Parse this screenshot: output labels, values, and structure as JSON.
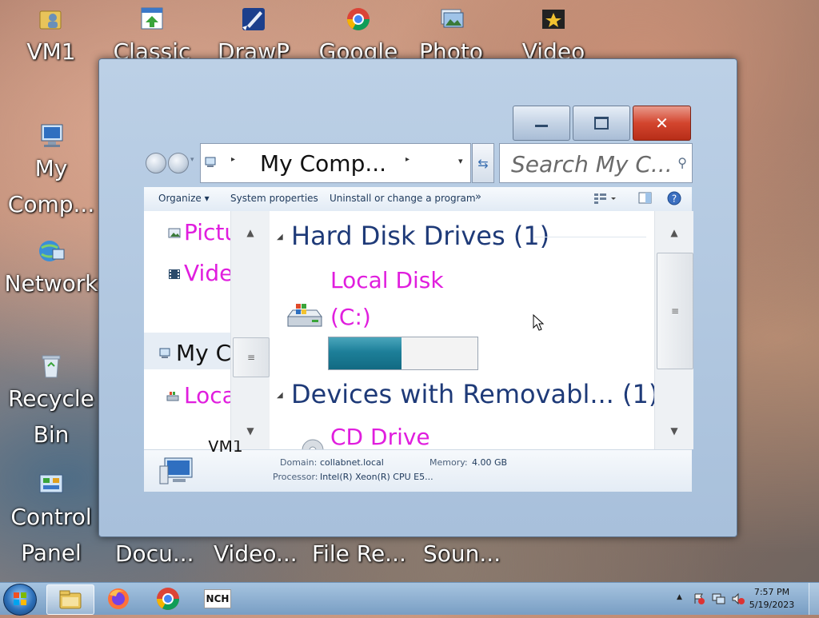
{
  "desktop": {
    "icons": [
      {
        "label": "VM1",
        "icon": "folder-user-icon"
      },
      {
        "label": "Classic",
        "icon": "app-shortcut-icon"
      },
      {
        "label": "DrawP",
        "icon": "drawing-app-icon"
      },
      {
        "label": "Google",
        "icon": "chrome-shortcut-icon"
      },
      {
        "label": "Photo",
        "icon": "photo-app-icon"
      },
      {
        "label": "Video",
        "icon": "video-app-icon"
      },
      {
        "label": "My Comp...",
        "icon": "computer-icon"
      },
      {
        "label": "Network",
        "icon": "network-icon"
      },
      {
        "label": "Recycle Bin",
        "icon": "recycle-bin-icon"
      },
      {
        "label": "Control Panel",
        "icon": "control-panel-icon"
      },
      {
        "label": "Docu...",
        "icon": "documents-icon"
      },
      {
        "label": "Video...",
        "icon": "video-icon"
      },
      {
        "label": "File Re...",
        "icon": "file-recovery-icon"
      },
      {
        "label": "Soun...",
        "icon": "sound-icon"
      }
    ]
  },
  "window": {
    "address": "My Comp...",
    "search_placeholder": "Search My C...",
    "toolbar": {
      "organize": "Organize ▾",
      "system_properties": "System properties",
      "uninstall": "Uninstall or change a program",
      "more": "»"
    },
    "nav_pane": {
      "items": [
        "Pictu",
        "Vide",
        "My C",
        "Loca"
      ]
    },
    "groups": {
      "hard_disk": "Hard Disk Drives (1)",
      "removable": "Devices with Removabl... (1)"
    },
    "drives": {
      "local_disk_line1": "Local Disk",
      "local_disk_line2": "(C:)",
      "local_disk_used_fraction": 0.49,
      "cd_drive": "CD Drive"
    },
    "details": {
      "computer_name": "VM1",
      "domain_label": "Domain:",
      "domain_value": "collabnet.local",
      "memory_label": "Memory:",
      "memory_value": "4.00 GB",
      "processor_label": "Processor:",
      "processor_value": "Intel(R) Xeon(R) CPU E5..."
    }
  },
  "taskbar": {
    "time": "7:57 PM",
    "date": "5/19/2023",
    "apps": [
      "file-explorer-icon",
      "firefox-icon",
      "chrome-icon",
      "nch-software-icon"
    ],
    "nch_label": "NCH"
  },
  "colors": {
    "link_magenta": "#e01ede",
    "group_header": "#1e3a78",
    "close_red": "#c8391f"
  }
}
